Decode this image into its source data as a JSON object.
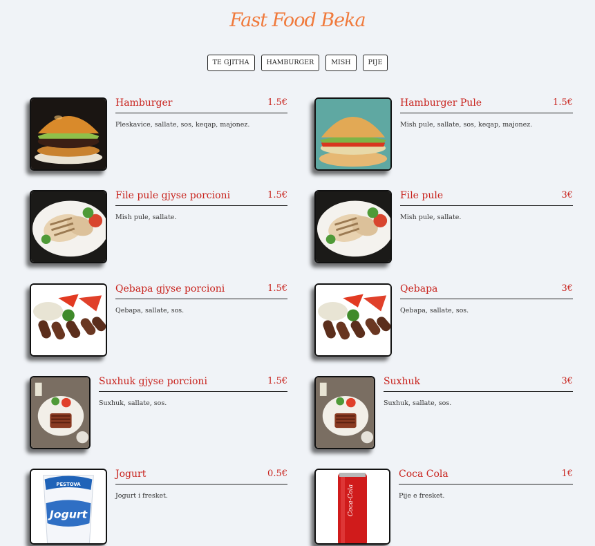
{
  "title": "Fast Food Beka",
  "filters": [
    "TE GJITHA",
    "HAMBURGER",
    "MISH",
    "PIJE"
  ],
  "items": [
    {
      "name": "Hamburger",
      "price": "1.5€",
      "desc": "Pleskavice, sallate, sos, keqap, majonez.",
      "image": "burger-image"
    },
    {
      "name": "Hamburger Pule",
      "price": "1.5€",
      "desc": "Mish pule, sallate, sos, keqap, majonez.",
      "image": "chicken-burger-image"
    },
    {
      "name": "File pule gjyse porcioni",
      "price": "1.5€",
      "desc": "Mish pule, sallate.",
      "image": "chicken-fillet-image"
    },
    {
      "name": "File pule",
      "price": "3€",
      "desc": "Mish pule, sallate.",
      "image": "chicken-fillet-image"
    },
    {
      "name": "Qebapa gjyse porcioni",
      "price": "1.5€",
      "desc": "Qebapa, sallate, sos.",
      "image": "qebapa-image"
    },
    {
      "name": "Qebapa",
      "price": "3€",
      "desc": "Qebapa, sallate, sos.",
      "image": "qebapa-image"
    },
    {
      "name": "Suxhuk gjyse porcioni",
      "price": "1.5€",
      "desc": "Suxhuk, sallate, sos.",
      "image": "suxhuk-image"
    },
    {
      "name": "Suxhuk",
      "price": "3€",
      "desc": "Suxhuk, sallate, sos.",
      "image": "suxhuk-image"
    },
    {
      "name": "Jogurt",
      "price": "0.5€",
      "desc": "Jogurt i fresket.",
      "image": "yogurt-cup-image"
    },
    {
      "name": "Coca Cola",
      "price": "1€",
      "desc": "Pije e fresket.",
      "image": "cola-can-image"
    }
  ],
  "yogurt_label": "Jogurt",
  "yogurt_brand": "PESTOVA",
  "cola_label": "Coca-Cola"
}
